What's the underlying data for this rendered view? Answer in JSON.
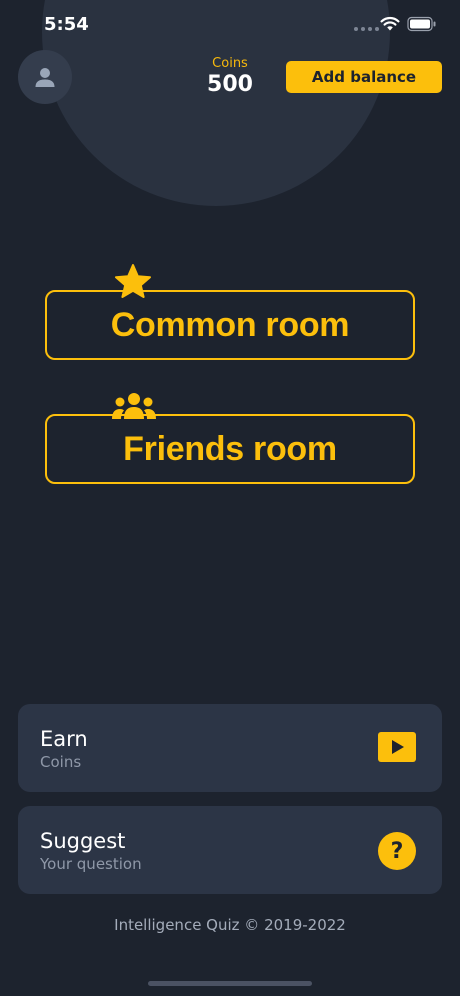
{
  "status_bar": {
    "time": "5:54"
  },
  "header": {
    "coins_label": "Coins",
    "coins_value": "500",
    "add_balance_label": "Add balance"
  },
  "rooms": {
    "common_label": "Common room",
    "friends_label": "Friends room"
  },
  "cards": {
    "earn": {
      "title": "Earn",
      "subtitle": "Coins"
    },
    "suggest": {
      "title": "Suggest",
      "subtitle": "Your question",
      "icon_glyph": "?"
    }
  },
  "footer": {
    "text": "Intelligence Quiz © 2019-2022"
  },
  "icons": {
    "avatar": "user-icon",
    "common_room": "star-icon",
    "friends_room": "people-icon",
    "earn": "play-icon",
    "suggest": "question-icon"
  },
  "colors": {
    "background": "#1d232e",
    "accent": "#fcbf0c",
    "card": "#2c3546"
  }
}
